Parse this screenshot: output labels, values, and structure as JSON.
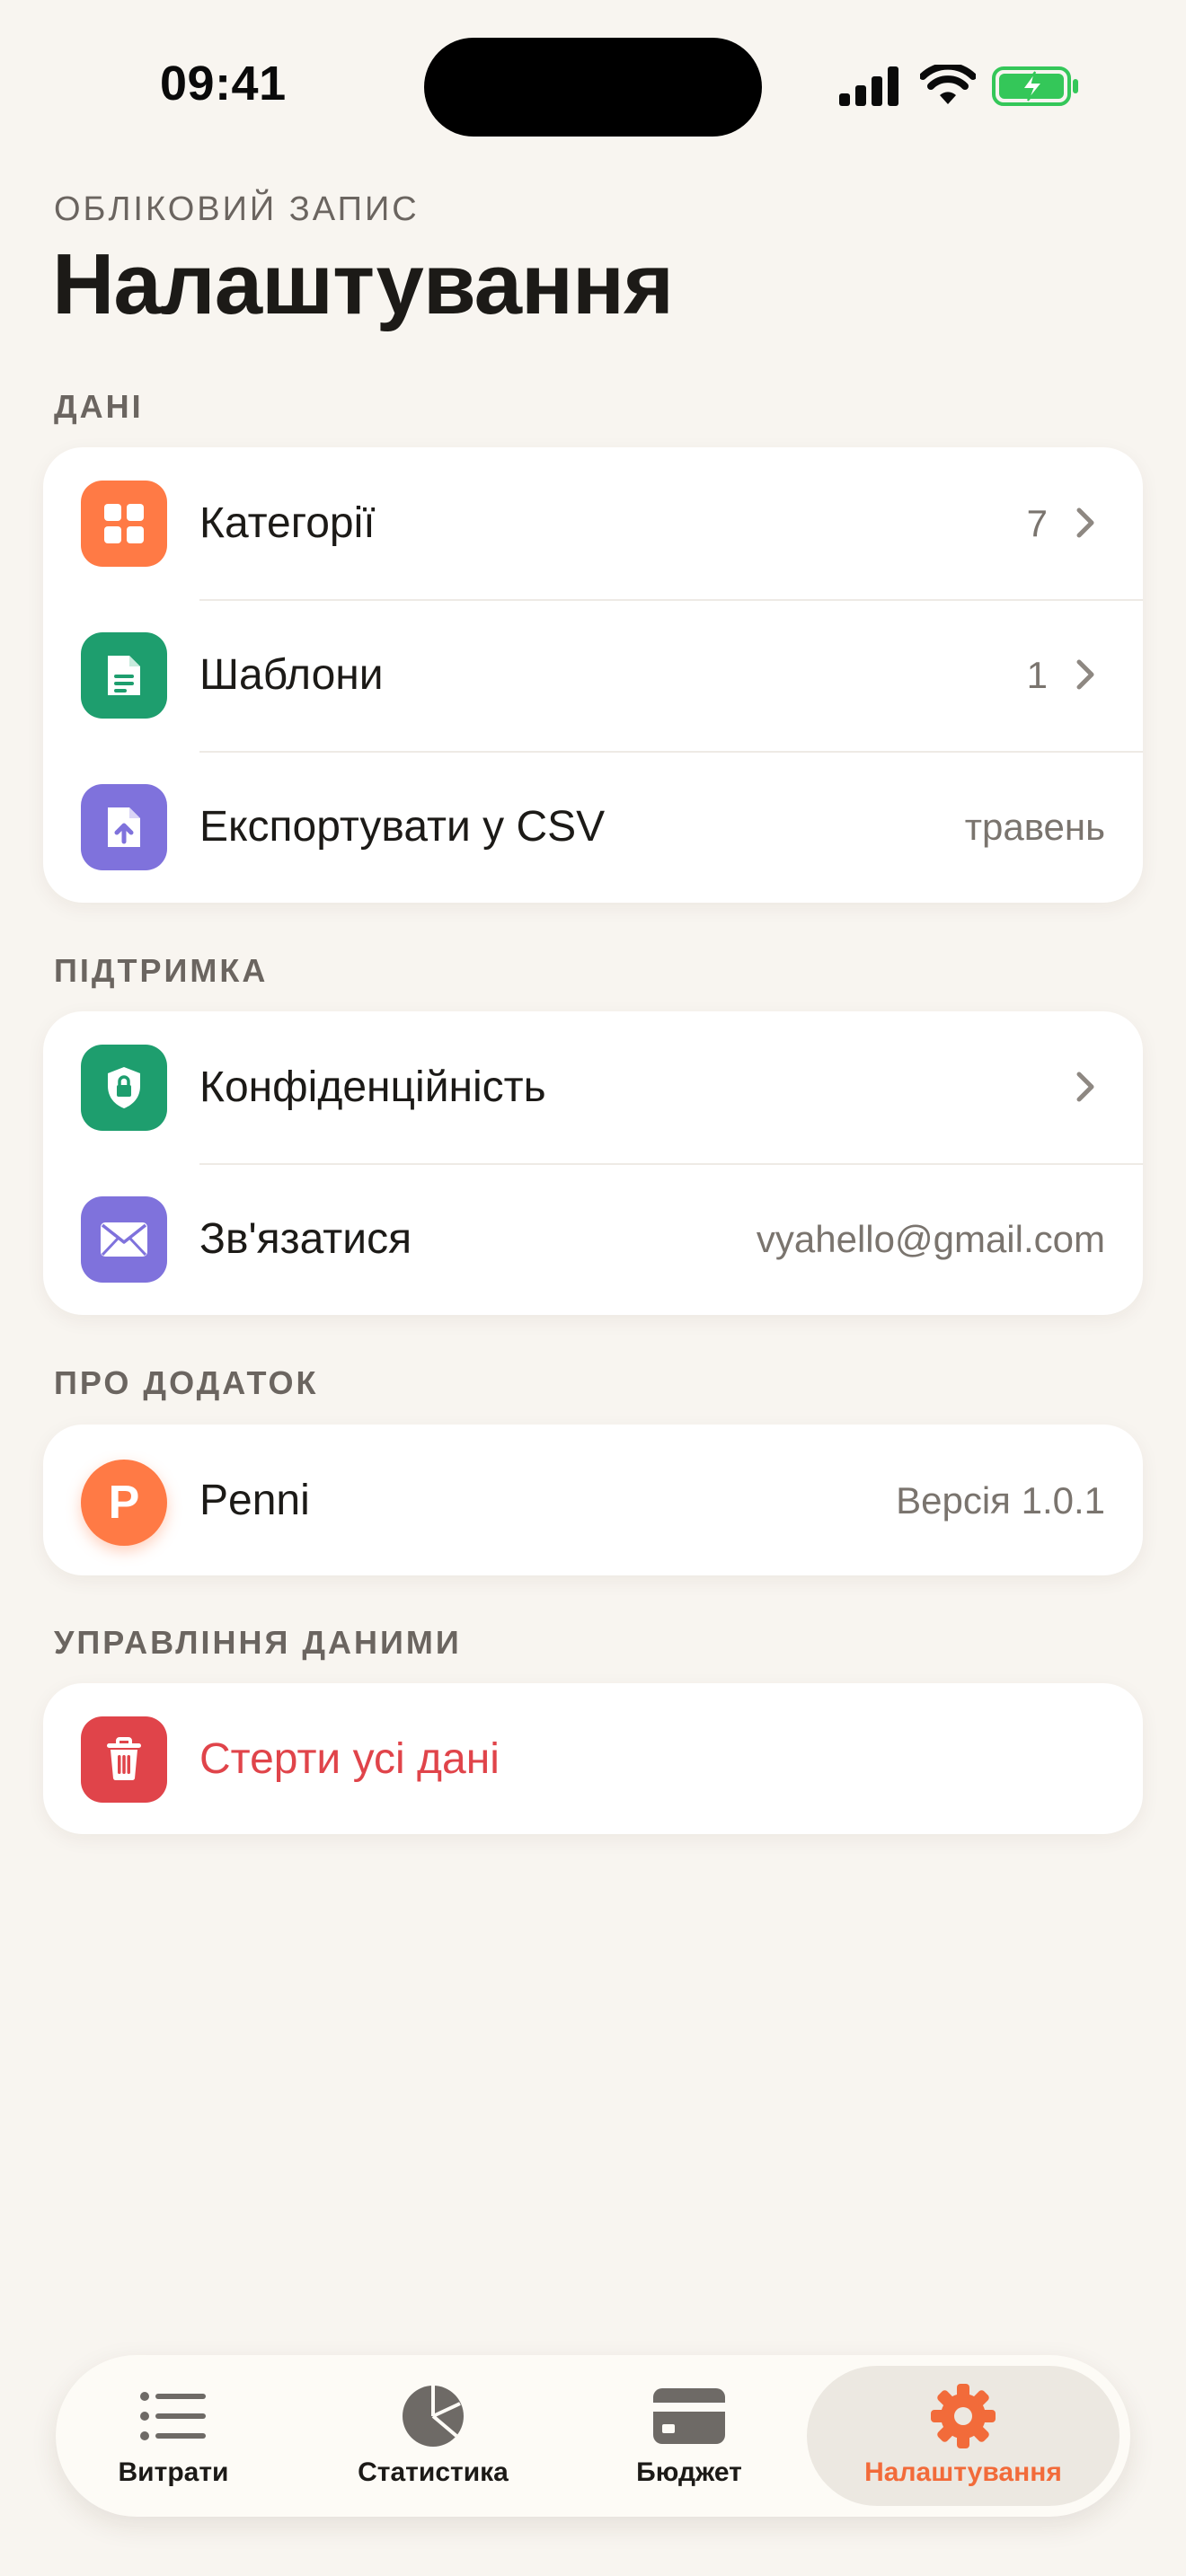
{
  "status_bar": {
    "time": "09:41"
  },
  "header": {
    "eyebrow": "ОБЛІКОВИЙ ЗАПИС",
    "title": "Налаштування"
  },
  "sections": {
    "data": {
      "label": "ДАНІ",
      "items": [
        {
          "label": "Категорії",
          "value": "7",
          "icon": "grid-icon"
        },
        {
          "label": "Шаблони",
          "value": "1",
          "icon": "document-icon"
        },
        {
          "label": "Експортувати у CSV",
          "value": "травень",
          "icon": "file-upload-icon"
        }
      ]
    },
    "support": {
      "label": "ПІДТРИМКА",
      "items": [
        {
          "label": "Конфіденційність",
          "value": "",
          "icon": "shield-lock-icon"
        },
        {
          "label": "Зв'язатися",
          "value": "vyahello@gmail.com",
          "icon": "envelope-icon"
        }
      ]
    },
    "about": {
      "label": "ПРО ДОДАТОК",
      "items": [
        {
          "label": "Penni",
          "value": "Версія 1.0.1",
          "logo_letter": "P"
        }
      ]
    },
    "data_management": {
      "label": "УПРАВЛІННЯ ДАНИМИ",
      "items": [
        {
          "label": "Стерти усі дані",
          "icon": "trash-icon"
        }
      ]
    }
  },
  "tabbar": {
    "tabs": [
      {
        "label": "Витрати",
        "icon": "list-icon",
        "active": false
      },
      {
        "label": "Статистика",
        "icon": "pie-chart-icon",
        "active": false
      },
      {
        "label": "Бюджет",
        "icon": "wallet-card-icon",
        "active": false
      },
      {
        "label": "Налаштування",
        "icon": "gear-icon",
        "active": true
      }
    ]
  },
  "colors": {
    "background": "#F8F5F0",
    "accent": "#FF7A45",
    "active_tab_text": "#F26B3A",
    "green": "#1E9E6E",
    "purple": "#7F72DC",
    "danger": "#E0444A",
    "battery_green": "#34C759"
  }
}
